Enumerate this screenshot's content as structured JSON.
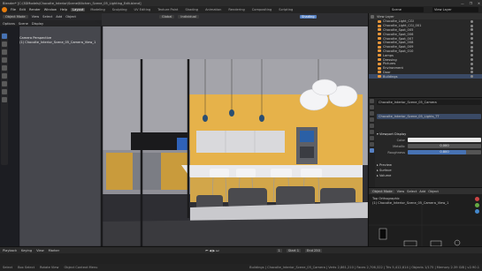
{
  "window": {
    "title": "Blender* [C:\\3DModels\\Chocolte_Interior\\Scene\\Kitchen_Scene_05_Lighting_Edit.blend]",
    "controls": [
      "—",
      "❐",
      "✕"
    ]
  },
  "menu": {
    "items": [
      "File",
      "Edit",
      "Render",
      "Window",
      "Help"
    ],
    "workspaces": [
      "Layout",
      "Modeling",
      "Sculpting",
      "UV Editing",
      "Texture Paint",
      "Shading",
      "Animation",
      "Rendering",
      "Compositing",
      "Scripting"
    ],
    "active_workspace": "Layout",
    "scene": "Scene",
    "view_layer": "View Layer"
  },
  "viewport": {
    "header": {
      "mode": "Object Mode",
      "menus": [
        "View",
        "Select",
        "Add",
        "Object"
      ],
      "orientation": "Global",
      "pivot": "Individual",
      "shading_label": "Shading"
    },
    "overlay_line1": "Camera Perspective",
    "overlay_line2": "(1) Chocolte_Interior_Scene_05_Camera_View_1",
    "sub_header": [
      "Options",
      "Scene",
      "Display"
    ]
  },
  "outliner": {
    "header": "View Layer",
    "rows": [
      {
        "label": "Chocolte_Light_CGI",
        "selected": false
      },
      {
        "label": "Chocolte_Light_CGI_001",
        "selected": false
      },
      {
        "label": "Chocolte_Spot_005",
        "selected": false
      },
      {
        "label": "Chocolte_Spot_006",
        "selected": false
      },
      {
        "label": "Chocolte_Spot_007",
        "selected": false
      },
      {
        "label": "Chocolte_Spot_008",
        "selected": false
      },
      {
        "label": "Chocolte_Spot_009",
        "selected": false
      },
      {
        "label": "Chocolte_Spot_010",
        "selected": false
      },
      {
        "label": "Lamps",
        "selected": false
      },
      {
        "label": "Dressing",
        "selected": false
      },
      {
        "label": "Pictures",
        "selected": false
      },
      {
        "label": "Environment",
        "selected": false
      },
      {
        "label": "Door",
        "selected": false
      },
      {
        "label": "Buildings",
        "selected": true
      }
    ]
  },
  "properties": {
    "object_name": "Chocolte_Interior_Scene_05_Camera",
    "material": "Chocolte_Interior_Scene_05_Lights_TT",
    "panel": "Viewport Display",
    "fields": [
      {
        "label": "Color",
        "value": ""
      },
      {
        "label": "Metallic",
        "value": "0.000",
        "fraction": 0.0
      },
      {
        "label": "Roughness",
        "value": "0.800",
        "fraction": 0.8
      }
    ],
    "sections": [
      "Preview",
      "Surface",
      "Volume"
    ]
  },
  "image_editor": {
    "header": [
      "Object Mode",
      "View",
      "Select",
      "Add",
      "Object"
    ],
    "lines": [
      "Top Orthographic",
      "(1) Chocolte_Interior_Scene_05_Camera_View_1"
    ]
  },
  "timeline": {
    "menus": [
      "Playback",
      "Keying",
      "View",
      "Marker"
    ],
    "start": "Start 1",
    "end": "End 250",
    "frame": "1"
  },
  "statusbar": {
    "left": [
      "Select",
      "Box Select",
      "Rotate View",
      "Object Context Menu"
    ],
    "right": "Buildings | Chocolte_Interior_Scene_05_Camera | Verts 2,861,210 | Faces 2,706,322 | Tris 5,412,614 | Objects 1/175 | Memory 2.39 GiB | v2.90.1"
  },
  "colors": {
    "accent": "#4772b3",
    "orange": "#e8963a",
    "wall_yellow": "#e6b24a"
  }
}
